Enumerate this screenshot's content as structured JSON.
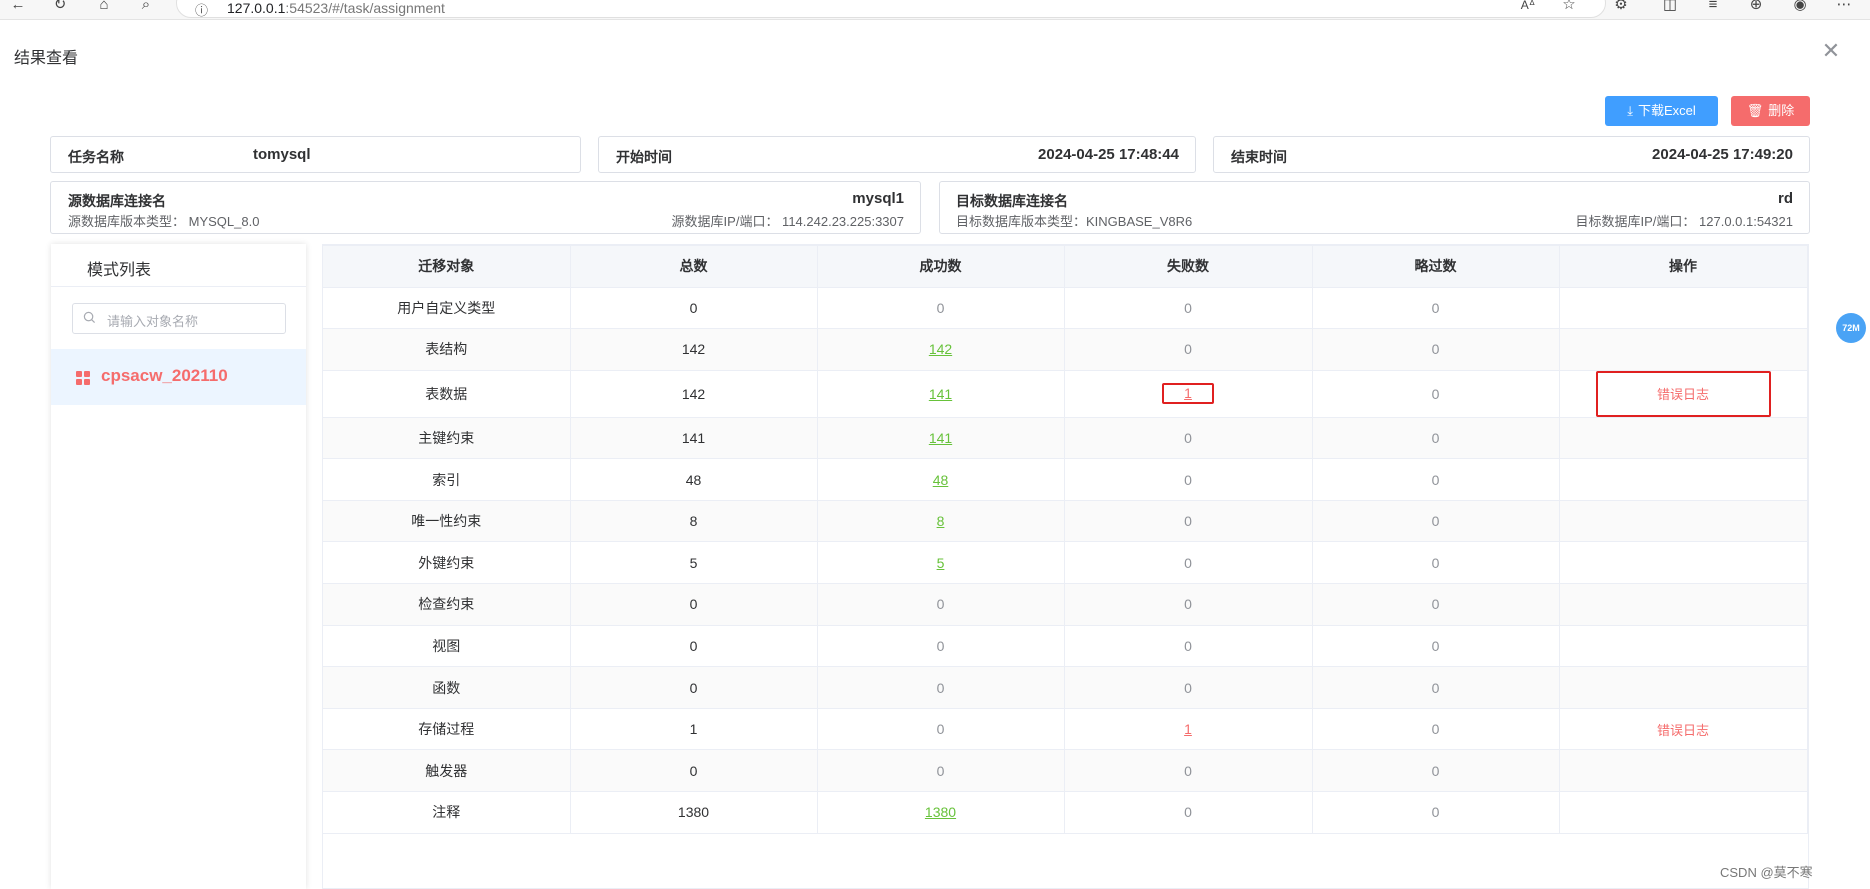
{
  "browser": {
    "url_host": "127.0.0.1",
    "url_rest": ":54523/#/task/assignment",
    "info_icon": "info-icon"
  },
  "dialog": {
    "title": "结果查看",
    "close_glyph": "✕"
  },
  "toolbar": {
    "excel_label": "下载Excel",
    "delete_label": "删除"
  },
  "task": {
    "name_label": "任务名称",
    "name_value": "tomysql",
    "start_label": "开始时间",
    "start_value": "2024-04-25 17:48:44",
    "end_label": "结束时间",
    "end_value": "2024-04-25 17:49:20"
  },
  "source": {
    "conn_label": "源数据库连接名",
    "conn_value": "mysql1",
    "version_text": "源数据库版本类型：  MYSQL_8.0",
    "ip_text": "源数据库IP/端口：  114.242.23.225:3307"
  },
  "target": {
    "conn_label": "目标数据库连接名",
    "conn_value": "rd",
    "version_text": "目标数据库版本类型：KINGBASE_V8R6",
    "ip_text": "目标数据库IP/端口：  127.0.0.1:54321"
  },
  "sidebar": {
    "title": "模式列表",
    "search_placeholder": "请输入对象名称",
    "schemas": [
      {
        "name": "cpsacw_202110"
      }
    ]
  },
  "table": {
    "columns": [
      "迁移对象",
      "总数",
      "成功数",
      "失败数",
      "略过数",
      "操作"
    ],
    "rows": [
      {
        "object": "用户自定义类型",
        "total": "0",
        "success": "0",
        "fail": "0",
        "skip": "0",
        "action": ""
      },
      {
        "object": "表结构",
        "total": "142",
        "success": "142",
        "fail": "0",
        "skip": "0",
        "action": ""
      },
      {
        "object": "表数据",
        "total": "142",
        "success": "141",
        "fail": "1",
        "skip": "0",
        "action": "错误日志"
      },
      {
        "object": "主键约束",
        "total": "141",
        "success": "141",
        "fail": "0",
        "skip": "0",
        "action": ""
      },
      {
        "object": "索引",
        "total": "48",
        "success": "48",
        "fail": "0",
        "skip": "0",
        "action": ""
      },
      {
        "object": "唯一性约束",
        "total": "8",
        "success": "8",
        "fail": "0",
        "skip": "0",
        "action": ""
      },
      {
        "object": "外键约束",
        "total": "5",
        "success": "5",
        "fail": "0",
        "skip": "0",
        "action": ""
      },
      {
        "object": "检查约束",
        "total": "0",
        "success": "0",
        "fail": "0",
        "skip": "0",
        "action": ""
      },
      {
        "object": "视图",
        "total": "0",
        "success": "0",
        "fail": "0",
        "skip": "0",
        "action": ""
      },
      {
        "object": "函数",
        "total": "0",
        "success": "0",
        "fail": "0",
        "skip": "0",
        "action": ""
      },
      {
        "object": "存储过程",
        "total": "1",
        "success": "0",
        "fail": "1",
        "skip": "0",
        "action": "错误日志"
      },
      {
        "object": "触发器",
        "total": "0",
        "success": "0",
        "fail": "0",
        "skip": "0",
        "action": ""
      },
      {
        "object": "注释",
        "total": "1380",
        "success": "1380",
        "fail": "0",
        "skip": "0",
        "action": ""
      }
    ]
  },
  "float_badge": "72M",
  "watermark": "CSDN @莫不寒",
  "colors": {
    "primary": "#409eff",
    "danger": "#f56c6c",
    "success": "#67c23a",
    "highlight": "#e02020"
  }
}
